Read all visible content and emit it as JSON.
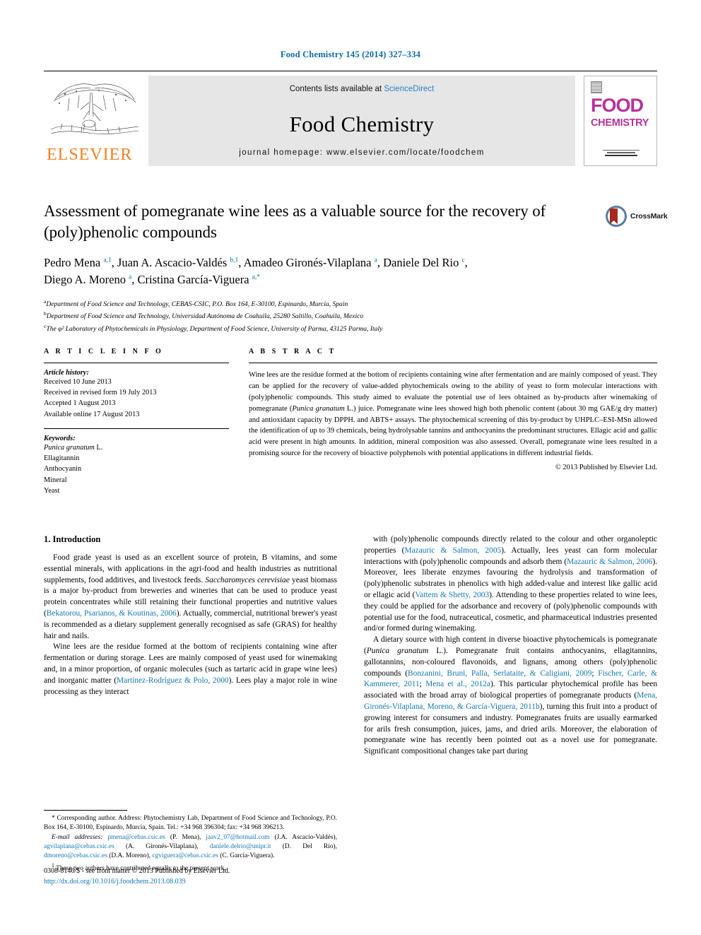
{
  "running_head": "Food Chemistry 145 (2014) 327–334",
  "masthead": {
    "contents_prefix": "Contents lists available at ",
    "sciencedirect": "ScienceDirect",
    "journal_title": "Food Chemistry",
    "homepage": "journal homepage: www.elsevier.com/locate/foodchem",
    "publisher_logo_text": "ELSEVIER",
    "cover": {
      "line1": "FOOD",
      "line2": "CHEMISTRY"
    }
  },
  "article": {
    "title": "Assessment of pomegranate wine lees as a valuable source for the recovery of (poly)phenolic compounds",
    "authors_line1_parts": [
      {
        "t": "Pedro Mena "
      },
      {
        "sup": "a,1"
      },
      {
        "t": ", Juan A. Ascacio-Valdés "
      },
      {
        "sup": "b,1"
      },
      {
        "t": ", Amadeo Gironés-Vilaplana "
      },
      {
        "sup": "a"
      },
      {
        "t": ", Daniele Del Rio "
      },
      {
        "sup": "c"
      },
      {
        "t": ","
      }
    ],
    "authors_line2_parts": [
      {
        "t": "Diego A. Moreno "
      },
      {
        "sup": "a"
      },
      {
        "t": ", Cristina García-Viguera "
      },
      {
        "sup": "a,*"
      }
    ],
    "affiliations": [
      {
        "marker": "a",
        "text": "Department of Food Science and Technology, CEBAS-CSIC, P.O. Box 164, E-30100, Espinardo, Murcia, Spain"
      },
      {
        "marker": "b",
        "text": "Department of Food Science and Technology, Universidad Autónoma de Coahuila, 25280 Saltillo, Coahuila, Mexico"
      },
      {
        "marker": "c",
        "text": "The φ² Laboratory of Phytochemicals in Physiology, Department of Food Science, University of Parma, 43125 Parma, Italy"
      }
    ],
    "crossmark_label": "CrossMark"
  },
  "article_info": {
    "heading": "A R T I C L E   I N F O",
    "history_label": "Article history:",
    "history": [
      "Received 10 June 2013",
      "Received in revised form 19 July 2013",
      "Accepted 1 August 2013",
      "Available online 17 August 2013"
    ],
    "keywords_label": "Keywords:",
    "keywords": [
      "Punica granatum L.",
      "Ellagitannin",
      "Anthocyanin",
      "Mineral",
      "Yeast"
    ]
  },
  "abstract": {
    "heading": "A B S T R A C T",
    "text": "Wine lees are the residue formed at the bottom of recipients containing wine after fermentation and are mainly composed of yeast. They can be applied for the recovery of value-added phytochemicals owing to the ability of yeast to form molecular interactions with (poly)phenolic compounds. This study aimed to evaluate the potential use of lees obtained as by-products after winemaking of pomegranate (Punica granatum L.) juice. Pomegranate wine lees showed high both phenolic content (about 30 mg GAE/g dry matter) and antioxidant capacity by DPPH. and ABTS+ assays. The phytochemical screening of this by-product by UHPLC–ESI-MSn allowed the identification of up to 39 chemicals, being hydrolysable tannins and anthocyanins the predominant structures. Ellagic acid and gallic acid were present in high amounts. In addition, mineral composition was also assessed. Overall, pomegranate wine lees resulted in a promising source for the recovery of bioactive polyphenols with potential applications in different industrial fields.",
    "copyright": "© 2013 Published by Elsevier Ltd."
  },
  "introduction": {
    "heading": "1. Introduction",
    "left_paragraphs": [
      "Food grade yeast is used as an excellent source of protein, B vitamins, and some essential minerals, with applications in the agri-food and health industries as nutritional supplements, food additives, and livestock feeds. Saccharomyces cerevisiae yeast biomass is a major by-product from breweries and wineries that can be used to produce yeast protein concentrates while still retaining their functional properties and nutritive values (Bekatorou, Psarianos, & Koutinas, 2006). Actually, commercial, nutritional brewer's yeast is recommended as a dietary supplement generally recognised as safe (GRAS) for healthy hair and nails.",
      "Wine lees are the residue formed at the bottom of recipients containing wine after fermentation or during storage. Lees are mainly composed of yeast used for winemaking and, in a minor proportion, of organic molecules (such as tartaric acid in grape wine lees) and inorganic matter (Martínez-Rodríguez & Polo, 2000). Lees play a major role in wine processing as they interact"
    ],
    "right_paragraphs": [
      "with (poly)phenolic compounds directly related to the colour and other organoleptic properties (Mazauric & Salmon, 2005). Actually, lees yeast can form molecular interactions with (poly)phenolic compounds and adsorb them (Mazauric & Salmon, 2006). Moreover, lees liberate enzymes favouring the hydrolysis and transformation of (poly)phenolic substrates in phenolics with high added-value and interest like gallic acid or ellagic acid (Vattem & Shetty, 2003). Attending to these properties related to wine lees, they could be applied for the adsorbance and recovery of (poly)phenolic compounds with potential use for the food, nutraceutical, cosmetic, and pharmaceutical industries presented and/or formed during winemaking.",
      "A dietary source with high content in diverse bioactive phytochemicals is pomegranate (Punica granatum L.). Pomegranate fruit contains anthocyanins, ellagitannins, gallotannins, non-coloured flavonoids, and lignans, among others (poly)phenolic compounds (Bonzanini, Bruni, Palla, Serlataite, & Caligiani, 2009; Fischer, Carle, & Kammerer, 2011; Mena et al., 2012a). This particular phytochemical profile has been associated with the broad array of biological properties of pomegranate products (Mena, Gironés-Vilaplana, Moreno, & García-Viguera, 2011b), turning this fruit into a product of growing interest for consumers and industry. Pomegranates fruits are usually earmarked for arils fresh consumption, juices, jams, and dried arils. Moreover, the elaboration of pomegranate wine has recently been pointed out as a novel use for pomegranate. Significant compositional changes take part during"
    ]
  },
  "footnotes": {
    "corresponding": "* Corresponding author. Address: Phytochemistry Lab, Department of Food Science and Technology, P.O. Box 164, E-30100, Espinardo, Murcia, Spain. Tel.: +34 968 396304; fax: +34 968 396213.",
    "email_label": "E-mail addresses:",
    "emails": [
      {
        "addr": "pmena@cebas.csic.es",
        "who": "(P. Mena)"
      },
      {
        "addr": "jaav2_07@hotmail.com",
        "who": "(J.A. Ascacio-Valdés)"
      },
      {
        "addr": "agvilaplana@cebas.csic.es",
        "who": "(A. Gironés-Vilaplana)"
      },
      {
        "addr": "daniele.delrio@unipr.it",
        "who": "(D. Del Rio)"
      },
      {
        "addr": "dmoreno@cebas.csic.es",
        "who": "(D.A. Moreno)"
      },
      {
        "addr": "cgviguera@cebas.csic.es",
        "who": "(C. García-Viguera)"
      }
    ],
    "equal_contrib": "These two authors have contributed equally to the present work.",
    "equal_contrib_marker": "1"
  },
  "bottom": {
    "issn_line": "0308-8146/$ - see front matter © 2013 Published by Elsevier Ltd.",
    "doi": "http://dx.doi.org/10.1016/j.foodchem.2013.08.039"
  },
  "colors": {
    "link": "#1278b5",
    "running_head": "#0b6ba8",
    "elsevier_orange": "#f57f20",
    "cover_magenta": "#b7309b"
  }
}
